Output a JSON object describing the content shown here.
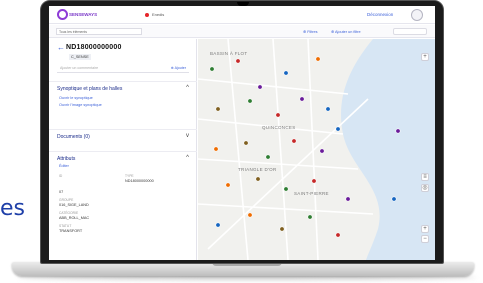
{
  "background_text": "es",
  "header": {
    "brand": "SENSEWAYS",
    "environment": "Enedis",
    "user_link": "Déconnexion"
  },
  "toolbar": {
    "selector": "Tous les éléments",
    "filters_label": "⊕ Filtres",
    "add_filter_label": "⊕ Ajouter un filtre"
  },
  "panel": {
    "object_id": "ND18000000000",
    "badge": "C_SENSE",
    "comment_placeholder": "Ajouter un commentaire",
    "comment_action": "⊕ Ajouter",
    "synoptic_title": "Synoptique et plans de halles",
    "synoptic_link1": "Ouvrir le synoptique",
    "synoptic_link2": "Ouvrir l'image synoptique",
    "documents_title": "Documents (0)",
    "attributes_title": "Attributs",
    "attributes_link": "Éditer",
    "attributes": [
      {
        "label": "ID",
        "value": "ND18000000000"
      },
      {
        "label": "TYPE",
        "value": "07"
      },
      {
        "label": "GROUPE",
        "value": "016_SIGE_LAND"
      },
      {
        "label": "CATÉGORIE",
        "value": "ABB_ROLL_MAC"
      },
      {
        "label": "STATUT",
        "value": "TRANSFORT"
      }
    ]
  },
  "map": {
    "districts": [
      "BASSIN À FLOT",
      "QUINCONCES",
      "TRIANGLE D'OR",
      "SAINT-PIERRE"
    ],
    "dot_colors": [
      "#2e7d32",
      "#c62828",
      "#6a1b9a",
      "#1565c0",
      "#ef6c00",
      "#7f5f1f"
    ],
    "river_color": "#d7e6f4"
  },
  "icons": [
    "logo-icon",
    "back-arrow-icon",
    "chevron-up-icon",
    "chevron-down-icon",
    "zoom-in-icon",
    "zoom-out-icon",
    "layers-icon",
    "locate-icon"
  ]
}
